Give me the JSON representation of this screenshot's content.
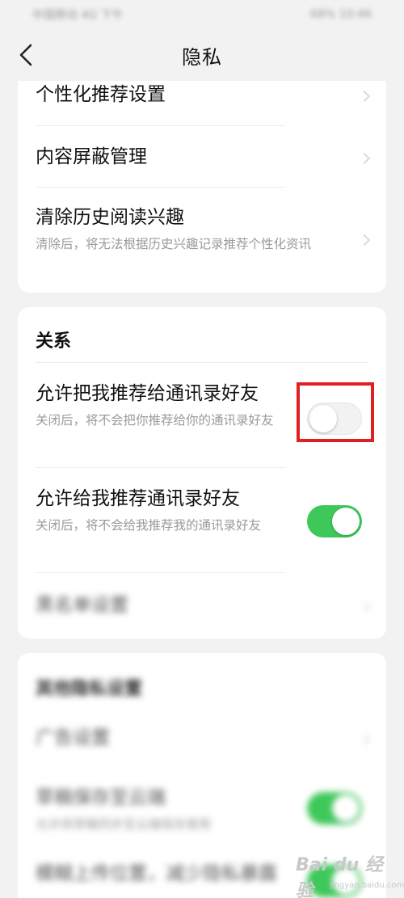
{
  "status_bar": {
    "carrier": "中国移动 4G 下午",
    "right": "68% 10:46"
  },
  "header": {
    "title": "隐私"
  },
  "privacy_items": [
    {
      "title": "个性化推荐设置",
      "subtitle": ""
    },
    {
      "title": "内容屏蔽管理",
      "subtitle": ""
    },
    {
      "title": "清除历史阅读兴趣",
      "subtitle": "清除后，将无法根据历史兴趣记录推荐个性化资讯"
    }
  ],
  "relations": {
    "section_title": "关系",
    "allow_recommend_me": {
      "title": "允许把我推荐给通讯录好友",
      "subtitle": "关闭后，将不会把你推荐给你的通讯录好友",
      "enabled": false
    },
    "allow_recommend_to_me": {
      "title": "允许给我推荐通讯录好友",
      "subtitle": "关闭后，将不会给我推荐我的通讯录好友",
      "enabled": true
    },
    "blacklist": {
      "title": "黑名单设置"
    }
  },
  "other_privacy": {
    "section_title": "其他隐私设置",
    "ad_settings": {
      "title": "广告设置"
    },
    "sync_item": {
      "title": "草稿保存至云端",
      "subtitle": "允许将草稿同步至云端保存使用",
      "enabled": true
    },
    "bottom_item": {
      "title": "模糊上传位置，减少隐私暴露"
    }
  },
  "colors": {
    "switch_on": "#3ec85a",
    "highlight": "#e02020",
    "background": "#f2f2f2"
  },
  "watermark": {
    "logo": "Bai du 经验",
    "site": "jingyan.baidu.com"
  }
}
